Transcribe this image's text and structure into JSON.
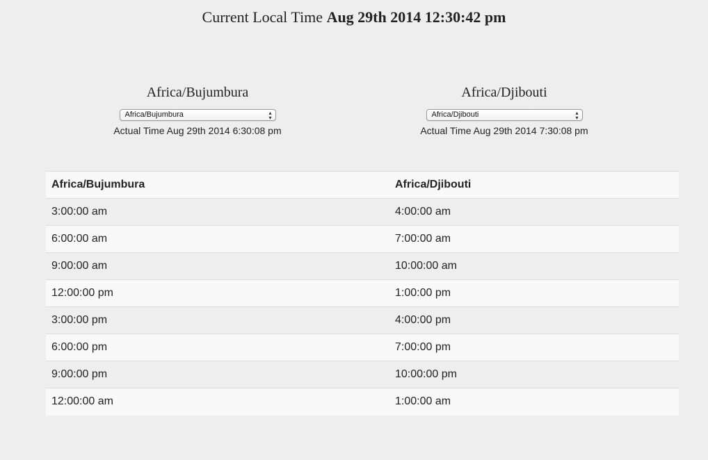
{
  "header": {
    "label": "Current Local Time",
    "time": "Aug 29th 2014 12:30:42 pm"
  },
  "zones": [
    {
      "title": "Africa/Bujumbura",
      "selected": "Africa/Bujumbura",
      "actual_label": "Actual Time",
      "actual_time": "Aug 29th 2014 6:30:08 pm"
    },
    {
      "title": "Africa/Djibouti",
      "selected": "Africa/Djibouti",
      "actual_label": "Actual Time",
      "actual_time": "Aug 29th 2014 7:30:08 pm"
    }
  ],
  "table": {
    "headers": [
      "Africa/Bujumbura",
      "Africa/Djibouti"
    ],
    "rows": [
      [
        "3:00:00 am",
        "4:00:00 am"
      ],
      [
        "6:00:00 am",
        "7:00:00 am"
      ],
      [
        "9:00:00 am",
        "10:00:00 am"
      ],
      [
        "12:00:00 pm",
        "1:00:00 pm"
      ],
      [
        "3:00:00 pm",
        "4:00:00 pm"
      ],
      [
        "6:00:00 pm",
        "7:00:00 pm"
      ],
      [
        "9:00:00 pm",
        "10:00:00 pm"
      ],
      [
        "12:00:00 am",
        "1:00:00 am"
      ]
    ]
  }
}
